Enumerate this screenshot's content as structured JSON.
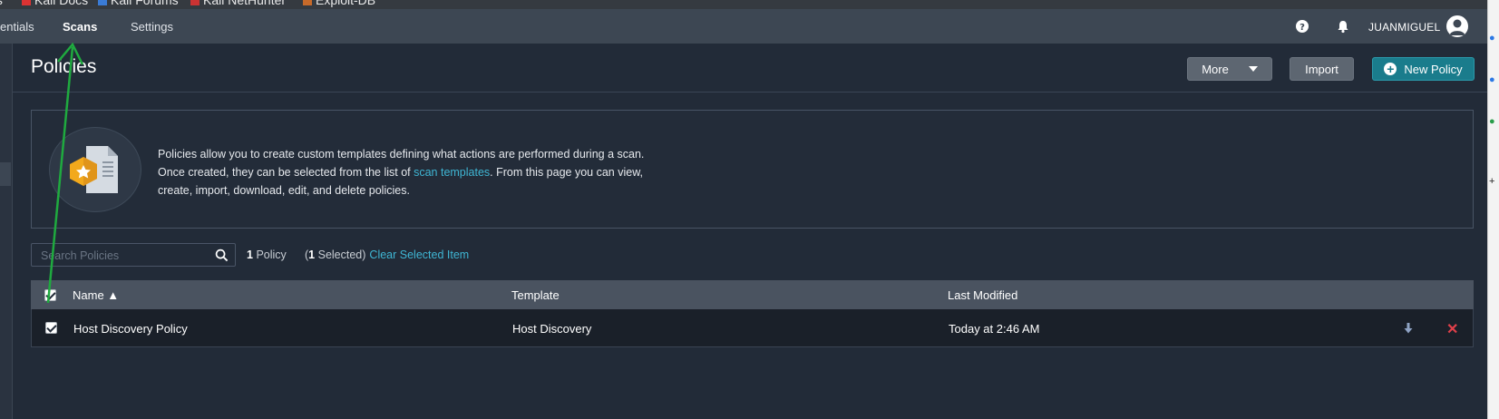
{
  "browser_bookmarks": [
    "Kali Docs",
    "Kali Forums",
    "Kali NetHunter",
    "Exploit-DB"
  ],
  "topnav": {
    "credentials_partial": "entials",
    "scans": "Scans",
    "settings": "Settings",
    "username": "JUANMIGUEL"
  },
  "header": {
    "title": "Policies",
    "more_label": "More",
    "import_label": "Import",
    "new_policy_label": "New Policy"
  },
  "info": {
    "line1": "Policies allow you to create custom templates defining what actions are performed during a scan.",
    "line2_before": "Once created, they can be selected from the list of ",
    "line2_link": "scan templates",
    "line2_after": ". From this page you can view,",
    "line3": "create, import, download, edit, and delete policies."
  },
  "toolbar": {
    "search_placeholder": "Search Policies",
    "count_number": "1",
    "count_label": "Policy",
    "selected_open": "(",
    "selected_number": "1",
    "selected_label": "Selected)",
    "clear_label": "Clear Selected Item"
  },
  "table": {
    "columns": {
      "name": "Name ▲",
      "template": "Template",
      "last_modified": "Last Modified"
    },
    "rows": [
      {
        "name": "Host Discovery Policy",
        "template": "Host Discovery",
        "last_modified": "Today at 2:46 AM",
        "selected": true
      }
    ]
  },
  "colors": {
    "background": "#222b38",
    "nav": "#3d4753",
    "accent_link": "#3fb6d4",
    "primary_button": "#1a7c8c",
    "delete": "#e0404a",
    "annotation_arrow": "#1faa3f"
  }
}
